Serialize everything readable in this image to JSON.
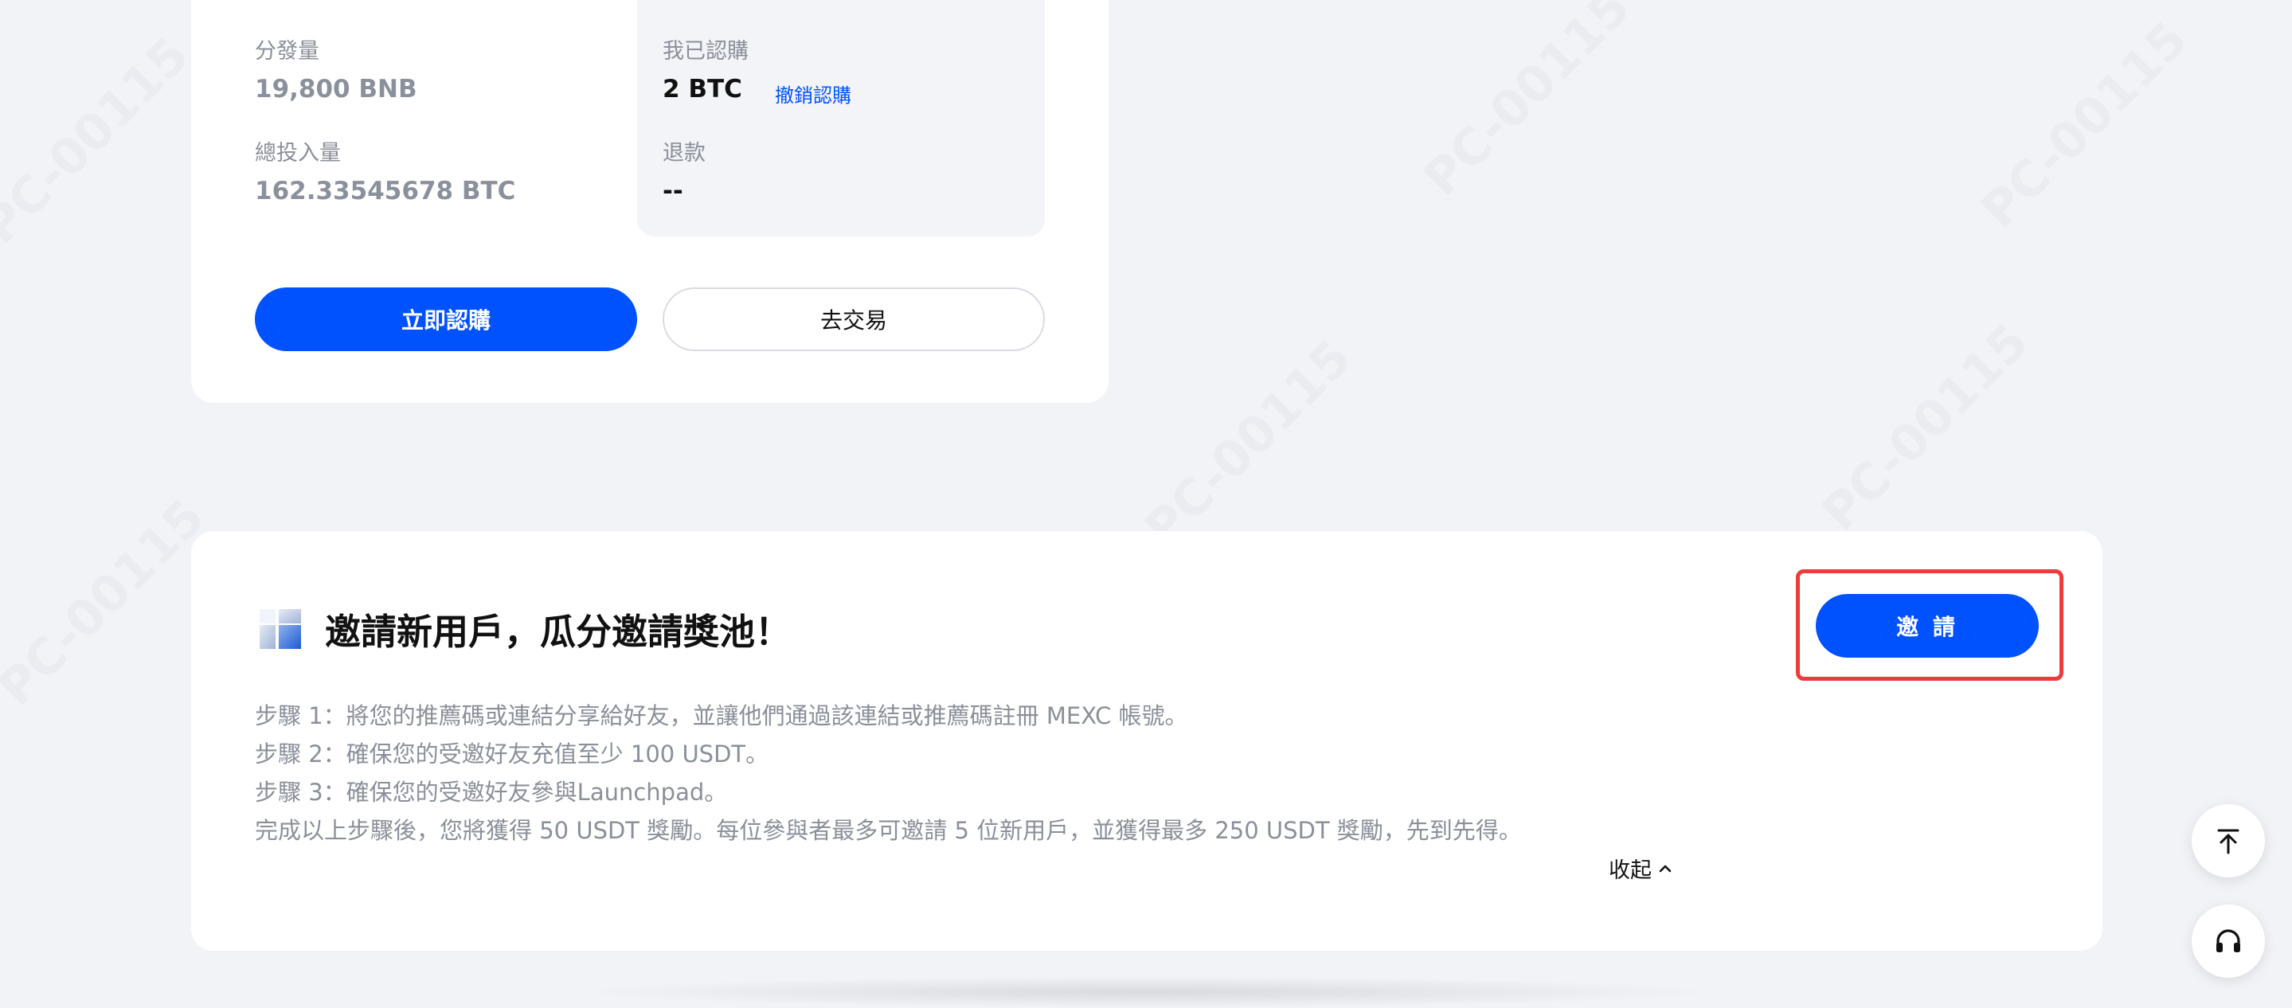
{
  "subscription": {
    "distribution_label": "分發量",
    "distribution_value": "19,800 BNB",
    "total_input_label": "總投入量",
    "total_input_value": "162.33545678 BTC",
    "my_subscribed_label": "我已認購",
    "my_subscribed_value": "2 BTC",
    "cancel_subscription_link": "撤銷認購",
    "refund_label": "退款",
    "refund_value": "--",
    "subscribe_now_button": "立即認購",
    "go_trade_button": "去交易"
  },
  "invite": {
    "title": "邀請新用戶，瓜分邀請獎池！",
    "invite_button": "邀 請",
    "steps": [
      "步驟 1：將您的推薦碼或連結分享給好友，並讓他們通過該連結或推薦碼註冊 MEXC 帳號。",
      "步驟 2：確保您的受邀好友充值至少 100 USDT。",
      "步驟 3：確保您的受邀好友參與Launchpad。",
      "完成以上步驟後，您將獲得 50 USDT 獎勵。每位參與者最多可邀請 5 位新用戶，並獲得最多 250 USDT 獎勵，先到先得。"
    ],
    "collapse_label": "收起"
  },
  "watermark_text": "PC-00115",
  "icons": {
    "title_icon": "blocks-icon",
    "collapse_icon": "chevron-up-icon",
    "back_to_top_icon": "arrow-up-to-top-icon",
    "support_icon": "headset-icon"
  },
  "colors": {
    "primary": "#0052ff",
    "background": "#f2f3f7",
    "highlight": "#ee3b3b"
  }
}
